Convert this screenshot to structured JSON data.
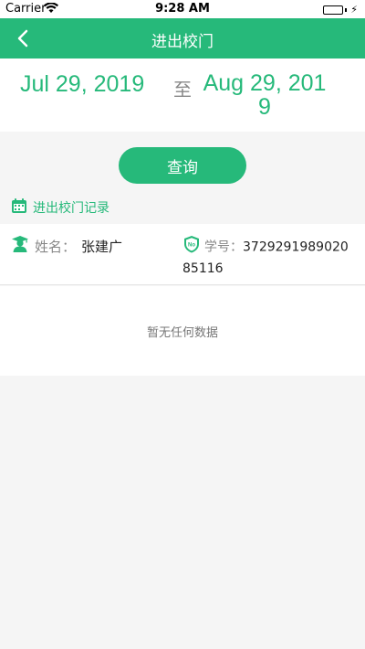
{
  "status_bar": {
    "carrier": "Carrier",
    "time": "9:28 AM"
  },
  "nav": {
    "title": "进出校门",
    "back_icon": "chevron-left-icon"
  },
  "date_range": {
    "start": "Jul 29, 2019",
    "separator": "至",
    "end": "Aug 29, 2019"
  },
  "query_button": {
    "label": "查询"
  },
  "section": {
    "title": "进出校门记录",
    "icon": "calendar-icon"
  },
  "student": {
    "name_label": "姓名：",
    "name": "张建广",
    "id_label": "学号：",
    "id": "372929198902085116"
  },
  "empty_state": {
    "text": "暂无任何数据"
  },
  "colors": {
    "accent": "#26b97a",
    "background": "#f5f5f5"
  }
}
